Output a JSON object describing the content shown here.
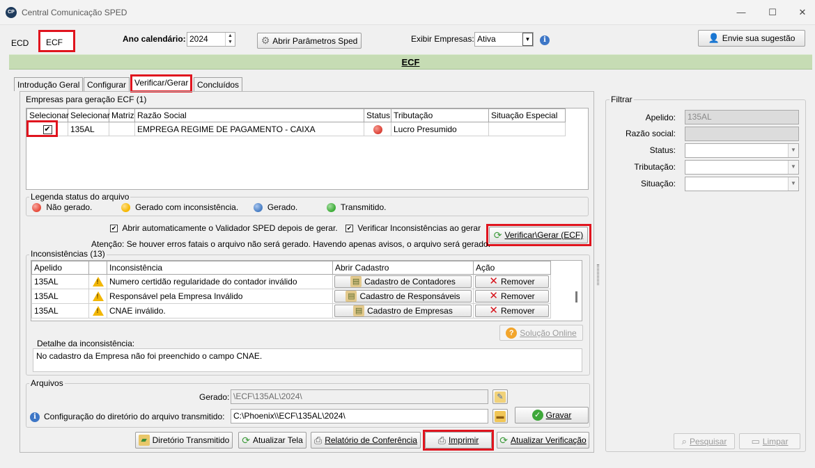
{
  "window": {
    "logo": "CP",
    "title": "Central Comunicação SPED",
    "minimize": "—",
    "maximize": "☐",
    "close": "✕"
  },
  "toolbar": {
    "tabs": [
      "ECD",
      "ECF"
    ],
    "ano_label": "Ano calendário:",
    "ano_value": "2024",
    "abrir_parametros": "Abrir Parâmetros Sped",
    "exibir_label": "Exibir Empresas:",
    "exibir_value": "Ativa",
    "sugestao": "Envie sua sugestão"
  },
  "banner": "ECF",
  "tabs": [
    "Introdução Geral",
    "Configurar",
    "Verificar/Gerar",
    "Concluídos"
  ],
  "empresas": {
    "title": "Empresas para geração ECF (1)",
    "columns": [
      "Selecionar",
      "Selecionar",
      "Matriz",
      "Razão Social",
      "Status",
      "Tributação",
      "Situação Especial"
    ],
    "rows": [
      {
        "checked": "✔",
        "selecionar": "135AL",
        "matriz": "",
        "razao": "EMPREGA REGIME DE PAGAMENTO - CAIXA",
        "status_color": "#e04a3f",
        "tributacao": "Lucro Presumido",
        "situacao": ""
      }
    ]
  },
  "legenda": {
    "title": "Legenda status do arquivo",
    "items": [
      {
        "label": "Não gerado.",
        "color": "#e74c3c"
      },
      {
        "label": "Gerado com inconsistência.",
        "color": "#f5b700"
      },
      {
        "label": "Gerado.",
        "color": "#4a7fc4"
      },
      {
        "label": "Transmitido.",
        "color": "#3fae3a"
      }
    ]
  },
  "options": {
    "abrir_validador": "Abrir automaticamente o Validador SPED depois de gerar.",
    "verificar_inconsistencias": "Verificar Inconsistências ao gerar",
    "check_mark": "✔",
    "verificar_gerar": "Verificar\\Gerar (ECF)",
    "atencao": "Atenção: Se houver erros fatais o arquivo não será gerado. Havendo apenas avisos, o arquivo será gerado."
  },
  "inconsistencias": {
    "title": "Inconsistências (13)",
    "columns": [
      "Apelido",
      "",
      "Inconsistência",
      "Abrir Cadastro",
      "Ação"
    ],
    "rows": [
      {
        "apelido": "135AL",
        "texto": "Numero certidão regularidade do contador inválido",
        "cadastro": "Cadastro de Contadores",
        "acao": "Remover"
      },
      {
        "apelido": "135AL",
        "texto": "Responsável pela Empresa Inválido",
        "cadastro": "Cadastro de Responsáveis",
        "acao": "Remover"
      },
      {
        "apelido": "135AL",
        "texto": "CNAE inválido.",
        "cadastro": "Cadastro de Empresas",
        "acao": "Remover"
      }
    ],
    "solucao_online": "Solução Online",
    "detalhe_label": "Detalhe da inconsistência:",
    "detalhe_texto": "No cadastro da Empresa não foi preenchido o campo CNAE."
  },
  "arquivos": {
    "title": "Arquivos",
    "gerado_label": "Gerado:",
    "gerado_value": "\\ECF\\135AL\\2024\\",
    "config_label": "Configuração do diretório do arquivo transmitido:",
    "config_value": "C:\\Phoenix\\\\ECF\\135AL\\2024\\",
    "gravar": "Gravar"
  },
  "bottom_buttons": {
    "diretorio": "Diretório Transmitido",
    "atualizar_tela": "Atualizar Tela",
    "relatorio": "Relatório de Conferência",
    "imprimir": "Imprimir",
    "atualizar_verificacao": "Atualizar Verificação"
  },
  "filtrar": {
    "title": "Filtrar",
    "apelido_label": "Apelido:",
    "apelido_value": "135AL",
    "razao_label": "Razão social:",
    "razao_value": "",
    "status_label": "Status:",
    "status_value": "",
    "tributacao_label": "Tributação:",
    "tributacao_value": "",
    "situacao_label": "Situação:",
    "situacao_value": "",
    "pesquisar": "Pesquisar",
    "limpar": "Limpar"
  }
}
